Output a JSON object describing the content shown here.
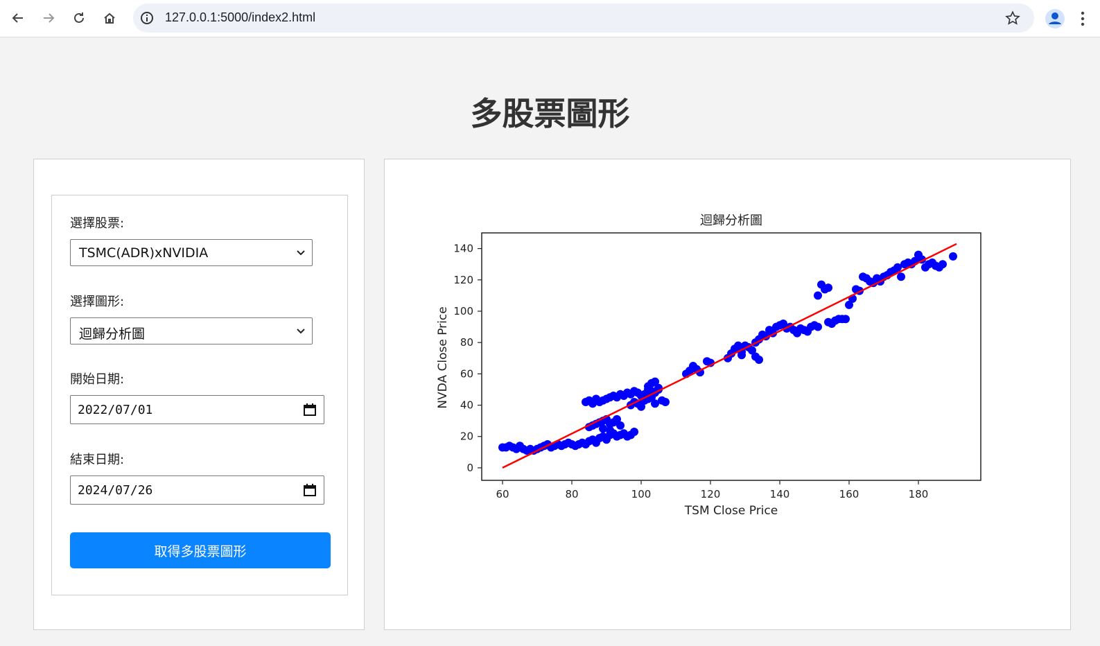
{
  "browser": {
    "url": "127.0.0.1:5000/index2.html"
  },
  "page": {
    "title": "多股票圖形"
  },
  "form": {
    "stock_label": "選擇股票:",
    "stock_value": "TSMC(ADR)xNVIDIA",
    "chart_label": "選擇圖形:",
    "chart_value": "迴歸分析圖",
    "start_label": "開始日期:",
    "start_value": "2022/07/01",
    "end_label": "結束日期:",
    "end_value": "2024/07/26",
    "submit_label": "取得多股票圖形"
  },
  "colors": {
    "accent": "#0a84ff",
    "points": "#0000ff",
    "regression": "#ff0000"
  },
  "chart_data": {
    "type": "scatter",
    "title": "迴歸分析圖",
    "xlabel": "TSM Close Price",
    "ylabel": "NVDA Close Price",
    "xlim": [
      54,
      198
    ],
    "ylim": [
      -8,
      150
    ],
    "xticks": [
      60,
      80,
      100,
      120,
      140,
      160,
      180
    ],
    "yticks": [
      0,
      20,
      40,
      60,
      80,
      100,
      120,
      140
    ],
    "grid": false,
    "regression_line": {
      "x": [
        60,
        191
      ],
      "y": [
        0,
        143
      ]
    },
    "points": [
      [
        60,
        13
      ],
      [
        61,
        13
      ],
      [
        62,
        14
      ],
      [
        63,
        13
      ],
      [
        64,
        12
      ],
      [
        65,
        14
      ],
      [
        66,
        12
      ],
      [
        67,
        11
      ],
      [
        68,
        12
      ],
      [
        69,
        11
      ],
      [
        70,
        12
      ],
      [
        71,
        13
      ],
      [
        72,
        14
      ],
      [
        73,
        15
      ],
      [
        74,
        13
      ],
      [
        75,
        14
      ],
      [
        76,
        15
      ],
      [
        77,
        14
      ],
      [
        78,
        15
      ],
      [
        79,
        16
      ],
      [
        80,
        15
      ],
      [
        81,
        14
      ],
      [
        82,
        15
      ],
      [
        83,
        16
      ],
      [
        84,
        15
      ],
      [
        85,
        17
      ],
      [
        86,
        18
      ],
      [
        87,
        16
      ],
      [
        88,
        19
      ],
      [
        89,
        20
      ],
      [
        90,
        18
      ],
      [
        91,
        21
      ],
      [
        92,
        22
      ],
      [
        93,
        20
      ],
      [
        94,
        21
      ],
      [
        95,
        22
      ],
      [
        96,
        20
      ],
      [
        97,
        21
      ],
      [
        98,
        23
      ],
      [
        85,
        26
      ],
      [
        86,
        27
      ],
      [
        87,
        28
      ],
      [
        88,
        29
      ],
      [
        89,
        30
      ],
      [
        90,
        31
      ],
      [
        91,
        28
      ],
      [
        92,
        29
      ],
      [
        93,
        31
      ],
      [
        94,
        27
      ],
      [
        89,
        25
      ],
      [
        91,
        24
      ],
      [
        84,
        42
      ],
      [
        85,
        43
      ],
      [
        86,
        41
      ],
      [
        87,
        44
      ],
      [
        88,
        42
      ],
      [
        89,
        43
      ],
      [
        90,
        44
      ],
      [
        91,
        45
      ],
      [
        92,
        46
      ],
      [
        93,
        45
      ],
      [
        94,
        47
      ],
      [
        95,
        46
      ],
      [
        96,
        48
      ],
      [
        97,
        47
      ],
      [
        98,
        49
      ],
      [
        99,
        48
      ],
      [
        100,
        46
      ],
      [
        101,
        47
      ],
      [
        102,
        50
      ],
      [
        103,
        49
      ],
      [
        104,
        48
      ],
      [
        105,
        50
      ],
      [
        106,
        43
      ],
      [
        107,
        42
      ],
      [
        97,
        40
      ],
      [
        98,
        42
      ],
      [
        99,
        41
      ],
      [
        100,
        39
      ],
      [
        101,
        43
      ],
      [
        102,
        44
      ],
      [
        103,
        45
      ],
      [
        104,
        41
      ],
      [
        102,
        52
      ],
      [
        103,
        54
      ],
      [
        104,
        55
      ],
      [
        105,
        51
      ],
      [
        113,
        60
      ],
      [
        114,
        62
      ],
      [
        115,
        65
      ],
      [
        116,
        63
      ],
      [
        117,
        61
      ],
      [
        119,
        68
      ],
      [
        120,
        67
      ],
      [
        125,
        70
      ],
      [
        126,
        73
      ],
      [
        127,
        76
      ],
      [
        128,
        78
      ],
      [
        129,
        74
      ],
      [
        130,
        78
      ],
      [
        131,
        77
      ],
      [
        132,
        75
      ],
      [
        133,
        80
      ],
      [
        134,
        82
      ],
      [
        135,
        85
      ],
      [
        136,
        84
      ],
      [
        137,
        88
      ],
      [
        138,
        86
      ],
      [
        139,
        90
      ],
      [
        140,
        91
      ],
      [
        141,
        92
      ],
      [
        142,
        89
      ],
      [
        143,
        90
      ],
      [
        144,
        88
      ],
      [
        145,
        86
      ],
      [
        146,
        89
      ],
      [
        147,
        88
      ],
      [
        148,
        87
      ],
      [
        149,
        90
      ],
      [
        150,
        91
      ],
      [
        151,
        90
      ],
      [
        133,
        71
      ],
      [
        134,
        69
      ],
      [
        129,
        72
      ],
      [
        151,
        110
      ],
      [
        152,
        117
      ],
      [
        153,
        114
      ],
      [
        154,
        115
      ],
      [
        154,
        93
      ],
      [
        155,
        92
      ],
      [
        156,
        94
      ],
      [
        157,
        95
      ],
      [
        158,
        95
      ],
      [
        159,
        95
      ],
      [
        160,
        104
      ],
      [
        161,
        108
      ],
      [
        162,
        114
      ],
      [
        163,
        113
      ],
      [
        164,
        122
      ],
      [
        165,
        121
      ],
      [
        166,
        119
      ],
      [
        167,
        118
      ],
      [
        168,
        121
      ],
      [
        169,
        119
      ],
      [
        170,
        122
      ],
      [
        171,
        123
      ],
      [
        172,
        125
      ],
      [
        173,
        126
      ],
      [
        174,
        128
      ],
      [
        175,
        122
      ],
      [
        176,
        130
      ],
      [
        177,
        131
      ],
      [
        178,
        130
      ],
      [
        179,
        132
      ],
      [
        180,
        136
      ],
      [
        181,
        133
      ],
      [
        182,
        128
      ],
      [
        183,
        130
      ],
      [
        184,
        131
      ],
      [
        185,
        129
      ],
      [
        186,
        128
      ],
      [
        187,
        130
      ],
      [
        190,
        135
      ]
    ]
  }
}
